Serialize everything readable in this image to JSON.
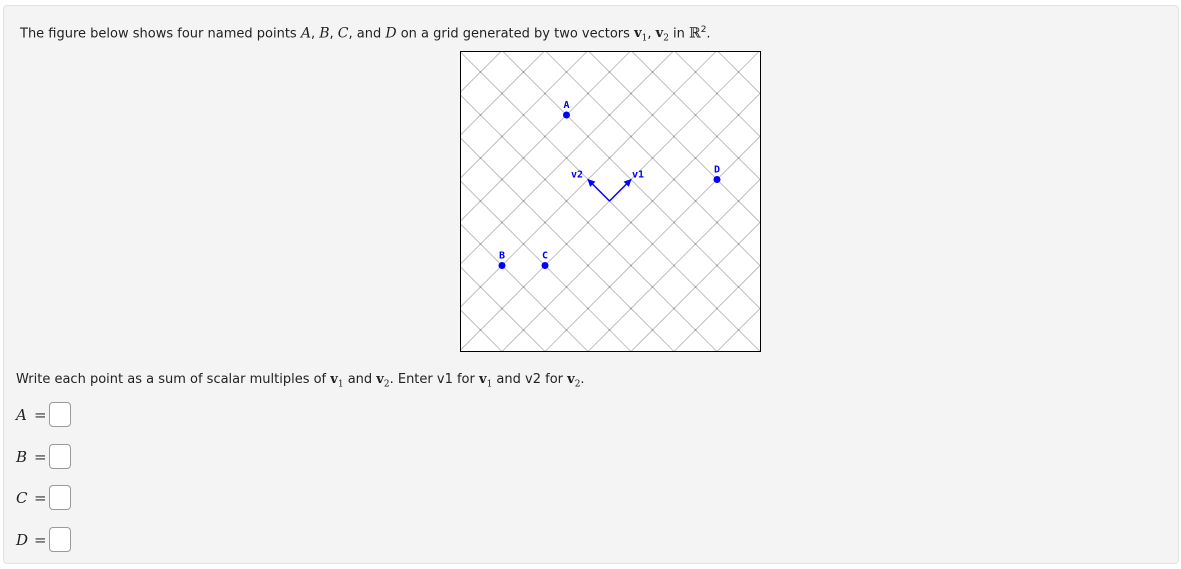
{
  "intro": {
    "text_before": "The figure below shows four named points ",
    "points": [
      "A",
      "B",
      "C",
      "D"
    ],
    "sep1": ", ",
    "sep2": ", ",
    "sep3": ", and ",
    "text_mid": " on a grid generated by two vectors ",
    "v1": "v",
    "v1_sub": "1",
    "comma": ", ",
    "v2": "v",
    "v2_sub": "2",
    "text_in": " in ",
    "space": "ℝ",
    "space_sup": "2",
    "period": "."
  },
  "figure": {
    "vectors": [
      {
        "label": "v1",
        "grid_coords": [
          1,
          0
        ]
      },
      {
        "label": "v2",
        "grid_coords": [
          0,
          1
        ]
      }
    ],
    "points": [
      {
        "label": "A",
        "v1": 1,
        "v2": 3
      },
      {
        "label": "B",
        "v1": -4,
        "v2": 1
      },
      {
        "label": "C",
        "v1": -3,
        "v2": 0
      },
      {
        "label": "D",
        "v1": 3,
        "v2": -2
      }
    ],
    "colors": {
      "accent": "#0000ff",
      "grid": "#b4b4b4",
      "border": "#000000",
      "background": "#ffffff"
    }
  },
  "prompt": {
    "text1": "Write each point as a sum of scalar multiples of ",
    "v1": "v",
    "v1_sub": "1",
    "and1": " and ",
    "v2": "v",
    "v2_sub": "2",
    "text2": ". Enter v1 for ",
    "text3": " and v2 for ",
    "period": "."
  },
  "answers": [
    {
      "label": "A",
      "equals": "=",
      "value": ""
    },
    {
      "label": "B",
      "equals": "=",
      "value": ""
    },
    {
      "label": "C",
      "equals": "=",
      "value": ""
    },
    {
      "label": "D",
      "equals": "=",
      "value": ""
    }
  ]
}
